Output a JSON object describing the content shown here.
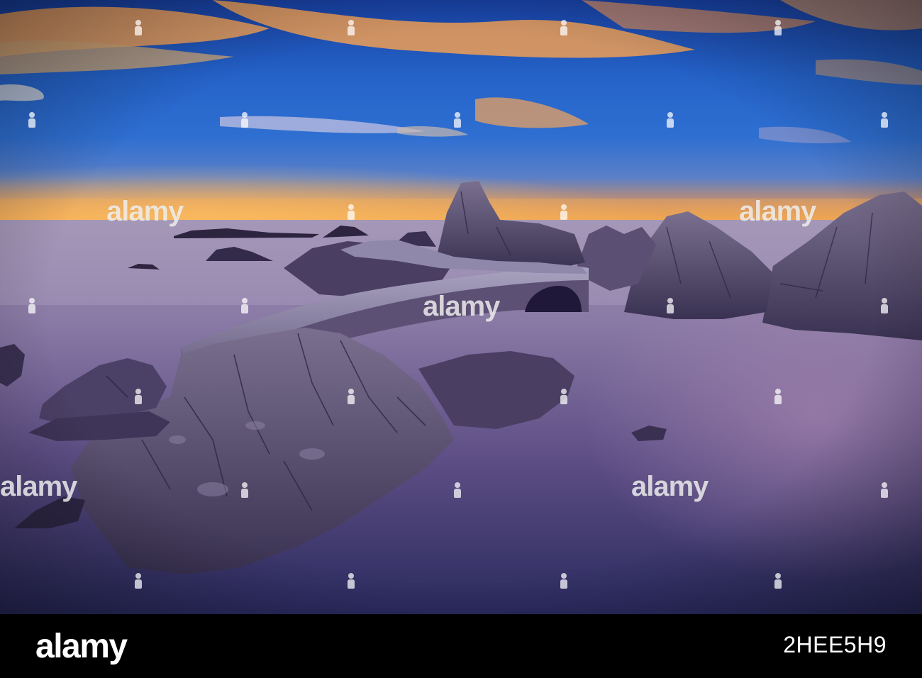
{
  "watermark": {
    "text": "alamy"
  },
  "footer": {
    "logo_text": "alamy",
    "image_id": "2HEE5H9"
  },
  "colors": {
    "sky_top": "#1f4fc2",
    "sky_mid": "#2d6fd6",
    "horizon_glow": "#f5a84a",
    "sea": "#6b5a8c",
    "rock": "#5a4f70",
    "footer_bg": "#000000",
    "footer_text": "#ffffff"
  }
}
